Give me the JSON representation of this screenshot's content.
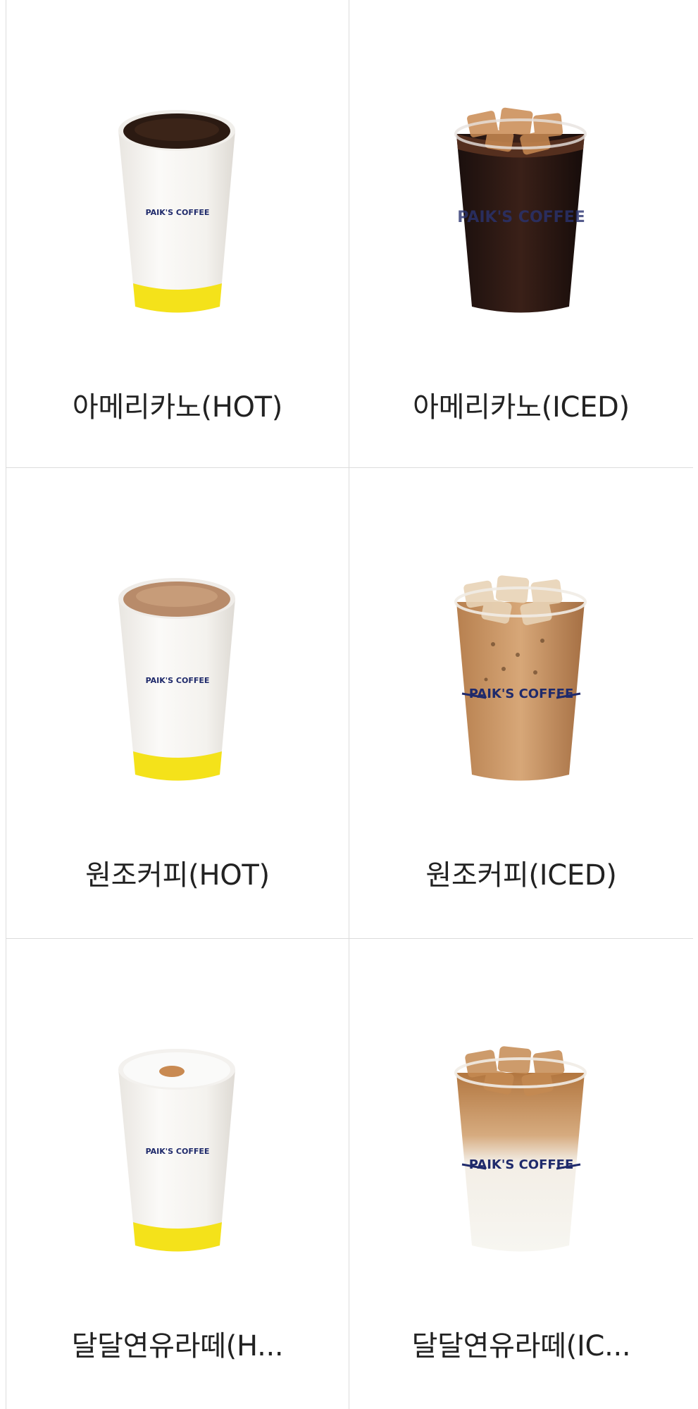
{
  "menu": {
    "items": [
      {
        "name": "아메리카노(HOT)",
        "image_icon": "hot-cup-americano-icon",
        "brand": "PAIK'S COFFEE"
      },
      {
        "name": "아메리카노(ICED)",
        "image_icon": "iced-cup-americano-icon",
        "brand": "PAIK'S COFFEE"
      },
      {
        "name": "원조커피(HOT)",
        "image_icon": "hot-cup-original-coffee-icon",
        "brand": "PAIK'S COFFEE"
      },
      {
        "name": "원조커피(ICED)",
        "image_icon": "iced-cup-original-coffee-icon",
        "brand": "PAIK'S COFFEE"
      },
      {
        "name": "달달연유라떼(H...",
        "image_icon": "hot-cup-condensed-milk-latte-icon",
        "brand": "PAIK'S COFFEE"
      },
      {
        "name": "달달연유라떼(IC...",
        "image_icon": "iced-cup-condensed-milk-latte-icon",
        "brand": "PAIK'S COFFEE"
      }
    ]
  },
  "colors": {
    "brand_navy": "#1f2a6b",
    "cup_yellow_band": "#f4e21a",
    "grid_border": "#dcdcdc",
    "text": "#222222"
  }
}
